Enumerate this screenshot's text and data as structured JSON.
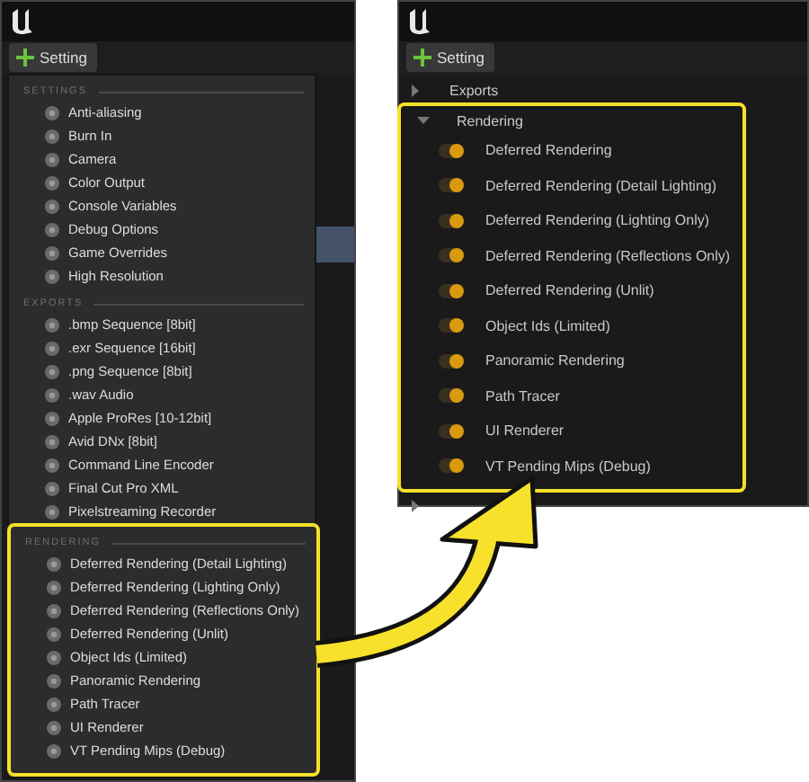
{
  "left_window": {
    "toolbar_button": "Setting",
    "menu": [
      {
        "title": "SETTINGS",
        "items": [
          "Anti-aliasing",
          "Burn In",
          "Camera",
          "Color Output",
          "Console Variables",
          "Debug Options",
          "Game Overrides",
          "High Resolution"
        ]
      },
      {
        "title": "EXPORTS",
        "items": [
          ".bmp Sequence [8bit]",
          ".exr Sequence [16bit]",
          ".png Sequence [8bit]",
          ".wav Audio",
          "Apple ProRes [10-12bit]",
          "Avid DNx [8bit]",
          "Command Line Encoder",
          "Final Cut Pro XML",
          "Pixelstreaming Recorder"
        ]
      }
    ],
    "highlight": {
      "title": "RENDERING",
      "items": [
        "Deferred Rendering (Detail Lighting)",
        "Deferred Rendering (Lighting Only)",
        "Deferred Rendering (Reflections Only)",
        "Deferred Rendering (Unlit)",
        "Object Ids (Limited)",
        "Panoramic Rendering",
        "Path Tracer",
        "UI Renderer",
        "VT Pending Mips (Debug)"
      ]
    }
  },
  "right_window": {
    "toolbar_button": "Setting",
    "tree": [
      {
        "label": "Exports",
        "expanded": false,
        "highlighted": false
      },
      {
        "label": "Rendering",
        "expanded": true,
        "highlighted": true,
        "children": [
          {
            "label": "Deferred Rendering",
            "on": true
          },
          {
            "label": "Deferred Rendering (Detail Lighting)",
            "on": true
          },
          {
            "label": "Deferred Rendering (Lighting Only)",
            "on": true
          },
          {
            "label": "Deferred Rendering (Reflections Only)",
            "on": true
          },
          {
            "label": "Deferred Rendering (Unlit)",
            "on": true
          },
          {
            "label": "Object Ids (Limited)",
            "on": true
          },
          {
            "label": "Panoramic Rendering",
            "on": true
          },
          {
            "label": "Path Tracer",
            "on": true
          },
          {
            "label": "UI Renderer",
            "on": true
          },
          {
            "label": "VT Pending Mips (Debug)",
            "on": true
          }
        ]
      },
      {
        "expanded": false,
        "highlighted": false
      }
    ]
  }
}
